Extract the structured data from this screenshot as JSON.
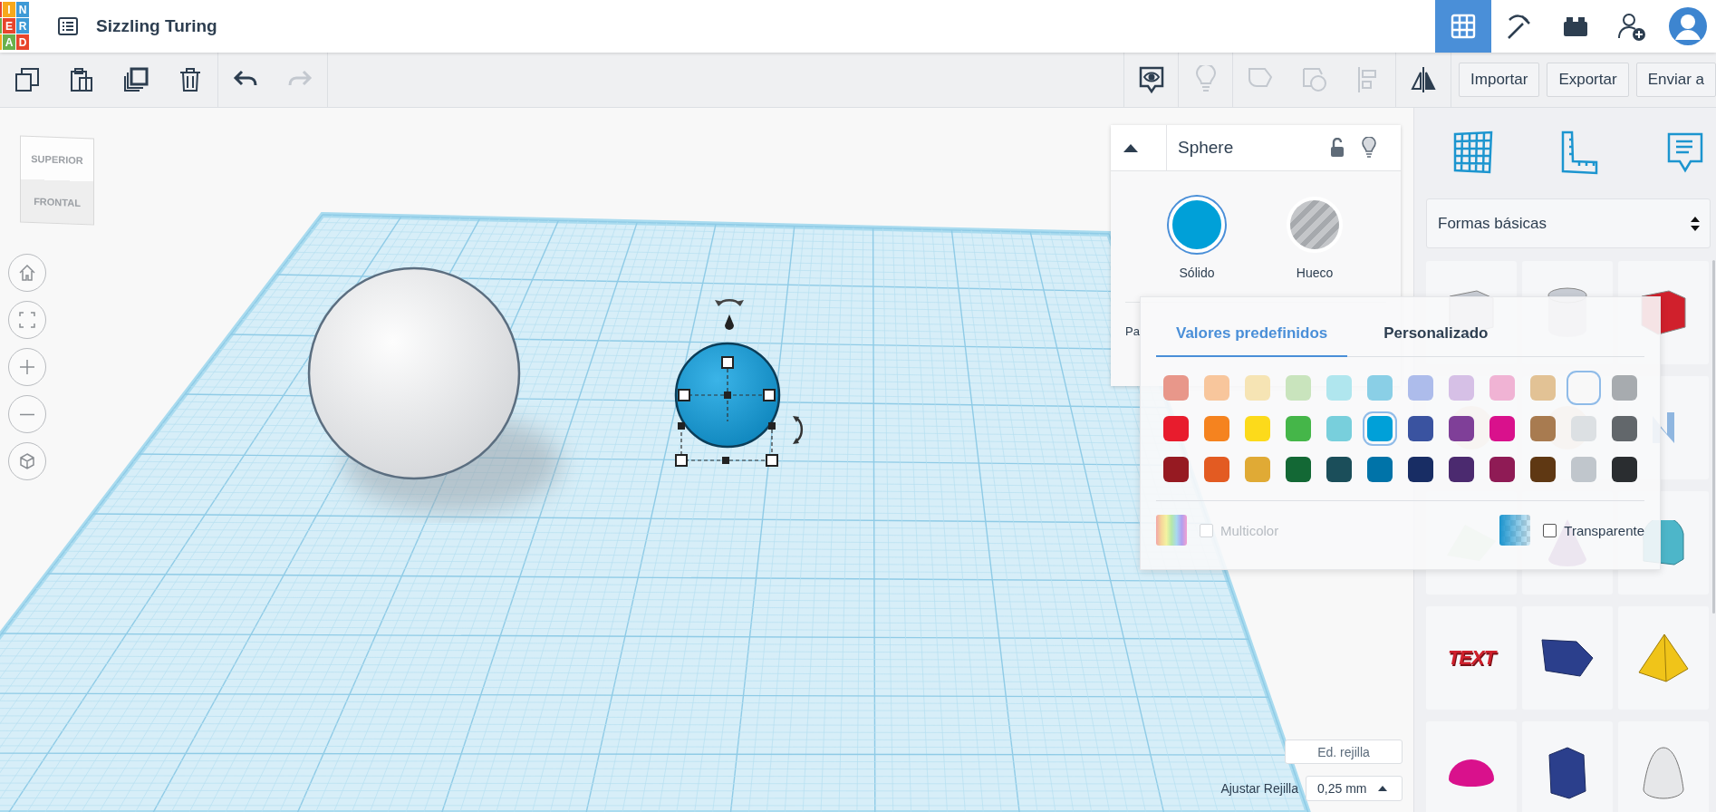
{
  "logo": {
    "letters": [
      "I",
      "N",
      "E",
      "R",
      "A",
      "D"
    ]
  },
  "project_title": "Sizzling Turing",
  "header_buttons": [
    {
      "kind": "grid",
      "selected": true
    },
    {
      "kind": "pickaxe",
      "selected": false
    },
    {
      "kind": "bricks",
      "selected": false
    },
    {
      "kind": "add-user",
      "selected": false
    },
    {
      "kind": "avatar",
      "selected": false
    }
  ],
  "toolbar": {
    "left": [
      {
        "kind": "copy",
        "disabled": false
      },
      {
        "kind": "paste",
        "disabled": false
      },
      {
        "kind": "duplicate",
        "disabled": false
      },
      {
        "kind": "delete",
        "disabled": false
      },
      {
        "kind": "undo",
        "disabled": false
      },
      {
        "kind": "redo",
        "disabled": true
      }
    ],
    "right": [
      {
        "kind": "notes",
        "disabled": false
      },
      {
        "kind": "bulb",
        "disabled": true
      },
      {
        "kind": "group",
        "disabled": true
      },
      {
        "kind": "ungroup",
        "disabled": true
      },
      {
        "kind": "align",
        "disabled": true
      },
      {
        "kind": "mirror",
        "disabled": false
      }
    ],
    "actions": [
      "Importar",
      "Exportar",
      "Enviar a"
    ]
  },
  "view_cube": {
    "top": "SUPERIOR",
    "front": "FRONTAL"
  },
  "nav_buttons": [
    {
      "kind": "home"
    },
    {
      "kind": "fit"
    },
    {
      "kind": "zoom-in"
    },
    {
      "kind": "zoom-out"
    },
    {
      "kind": "perspective"
    }
  ],
  "shape_panel": {
    "title": "Sphere",
    "modes": [
      {
        "label": "Sólido",
        "selected": true
      },
      {
        "label": "Hueco",
        "selected": false
      }
    ],
    "param_label": "Pa"
  },
  "color_picker": {
    "tabs": [
      {
        "label": "Valores predefinidos",
        "selected": true
      },
      {
        "label": "Personalizado",
        "selected": false
      }
    ],
    "swatches": [
      {
        "color": "#e8978a",
        "selected": false
      },
      {
        "color": "#f8c69c",
        "selected": false
      },
      {
        "color": "#f6e4b4",
        "selected": false
      },
      {
        "color": "#c9e4bd",
        "selected": false
      },
      {
        "color": "#b0e6ee",
        "selected": false
      },
      {
        "color": "#8acfe6",
        "selected": false
      },
      {
        "color": "#adbceb",
        "selected": false
      },
      {
        "color": "#d6c0e6",
        "selected": false
      },
      {
        "color": "#f0b3d4",
        "selected": false
      },
      {
        "color": "#e2c295",
        "selected": false
      },
      {
        "color": "#f8f8f8",
        "selected": true
      },
      {
        "color": "#a7abaf",
        "selected": false
      },
      {
        "color": "#e81c2d",
        "selected": false
      },
      {
        "color": "#f5831f",
        "selected": false
      },
      {
        "color": "#fcda1b",
        "selected": false
      },
      {
        "color": "#45b649",
        "selected": false
      },
      {
        "color": "#78cfdc",
        "selected": false
      },
      {
        "color": "#00a0d8",
        "selected": true
      },
      {
        "color": "#3a53a0",
        "selected": false
      },
      {
        "color": "#7f3f98",
        "selected": false
      },
      {
        "color": "#d9118c",
        "selected": false
      },
      {
        "color": "#a87b50",
        "selected": false
      },
      {
        "color": "#dce0e3",
        "selected": false
      },
      {
        "color": "#62676b",
        "selected": false
      },
      {
        "color": "#961a22",
        "selected": false
      },
      {
        "color": "#e35b22",
        "selected": false
      },
      {
        "color": "#e0aa35",
        "selected": false
      },
      {
        "color": "#136835",
        "selected": false
      },
      {
        "color": "#1b4e5a",
        "selected": false
      },
      {
        "color": "#0073a8",
        "selected": false
      },
      {
        "color": "#182d64",
        "selected": false
      },
      {
        "color": "#4b2a6f",
        "selected": false
      },
      {
        "color": "#8f1b55",
        "selected": false
      },
      {
        "color": "#5f3813",
        "selected": false
      },
      {
        "color": "#c0c6cc",
        "selected": false
      },
      {
        "color": "#2a2d30",
        "selected": false
      }
    ],
    "multicolor": {
      "label": "Multicolor",
      "checked": false,
      "disabled": true
    },
    "transparent": {
      "label": "Transparente",
      "checked": false,
      "disabled": false
    }
  },
  "library": {
    "tools": [
      {
        "kind": "workplane"
      },
      {
        "kind": "ruler"
      },
      {
        "kind": "notes"
      }
    ],
    "category": "Formas básicas",
    "shapes": [
      {
        "kind": "box-hole",
        "color": "#c8ccd4"
      },
      {
        "kind": "cylinder-hole",
        "color": "#c8ccd4"
      },
      {
        "kind": "box",
        "color": "#d0202c"
      },
      {
        "kind": "sphere"
      },
      {
        "kind": "sphere"
      },
      {
        "kind": "script"
      },
      {
        "kind": "roof"
      },
      {
        "kind": "cone"
      },
      {
        "kind": "half-cylinder"
      },
      {
        "kind": "text",
        "color": "#d0202c",
        "label": "TEXT"
      },
      {
        "kind": "wedge",
        "color": "#2b3f8c"
      },
      {
        "kind": "pyramid",
        "color": "#f0c419"
      },
      {
        "kind": "hemisphere",
        "color": "#d9118c"
      },
      {
        "kind": "polygon",
        "color": "#2b3f8c"
      },
      {
        "kind": "paraboloid",
        "color": "#e6e7e9"
      }
    ]
  },
  "grid_controls": {
    "edit_button": "Ed. rejilla",
    "snap_label": "Ajustar Rejilla",
    "snap_value": "0,25 mm"
  }
}
